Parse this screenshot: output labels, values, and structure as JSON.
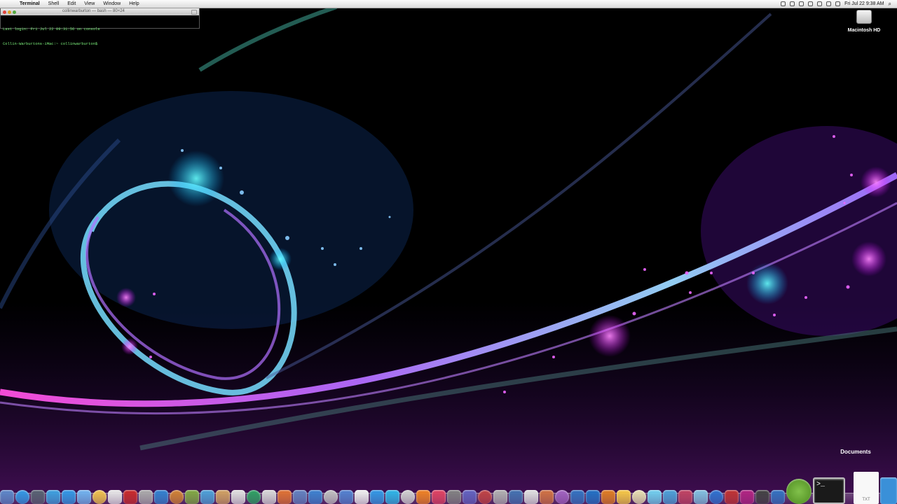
{
  "menubar": {
    "apple": "",
    "app_name": "Terminal",
    "items": [
      "Shell",
      "Edit",
      "View",
      "Window",
      "Help"
    ],
    "clock": "Fri Jul 22  9:38 AM",
    "spotlight": "⌕"
  },
  "terminal": {
    "title": "collinwarburton — bash — 80×24",
    "lines": [
      "Last login: Fri Jul 22 09:31:56 on console",
      "Collin-Warburtons-iMac:~ collinwarburton$"
    ]
  },
  "desktop": {
    "hd_label": "Macintosh HD"
  },
  "dock": {
    "tooltip": "Documents",
    "doc_label": "TXT",
    "terminal_prompt": ">_",
    "icon_colors": [
      "#5a86c8",
      "#2f97e6",
      "#556070",
      "#3aa0e0",
      "#2f97e6",
      "#6fb3f0",
      "#f1c24a",
      "#e8e8e8",
      "#c82727",
      "#aaaaaa",
      "#2f80d0",
      "#d08030",
      "#7fa840",
      "#4aa0d8",
      "#d0a060",
      "#e0e0e0",
      "#2aa060",
      "#d8d8d8",
      "#e07030",
      "#6080c0",
      "#3a80d0",
      "#c0c0c0",
      "#5080d0",
      "#f0f0f0",
      "#2f97e6",
      "#2bb5e8",
      "#d0d0d0",
      "#f08020",
      "#e04060",
      "#808080",
      "#6060c0",
      "#c04040",
      "#b0b0b0",
      "#4070b0",
      "#e0e0e0",
      "#d07040",
      "#a060c0",
      "#3070c0",
      "#1e6fc4",
      "#e07b1f",
      "#f7c843",
      "#e8e0b0",
      "#6fd0f0",
      "#4aa0d8",
      "#c04060",
      "#80c0e0",
      "#2a70d0",
      "#c03030",
      "#b02080",
      "#404040",
      "#3070c0"
    ]
  }
}
